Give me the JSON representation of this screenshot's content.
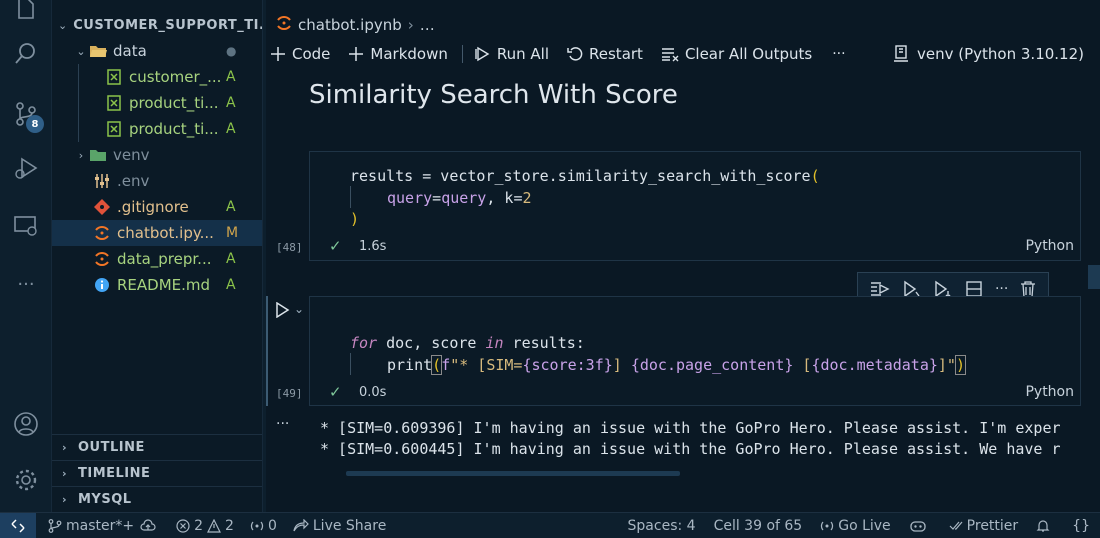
{
  "explorer": {
    "root": "CUSTOMER_SUPPORT_TI...",
    "items": [
      {
        "name": "data",
        "status": "●"
      },
      {
        "name": "customer_...",
        "status": "A"
      },
      {
        "name": "product_ti...",
        "status": "A"
      },
      {
        "name": "product_ti...",
        "status": "A"
      },
      {
        "name": "venv",
        "status": ""
      },
      {
        "name": ".env",
        "status": ""
      },
      {
        "name": ".gitignore",
        "status": "A"
      },
      {
        "name": "chatbot.ipy...",
        "status": "M"
      },
      {
        "name": "data_prepr...",
        "status": "A"
      },
      {
        "name": "README.md",
        "status": "A"
      }
    ],
    "sections": [
      "OUTLINE",
      "TIMELINE",
      "MYSQL"
    ]
  },
  "activity": {
    "source_control_badge": "8"
  },
  "editor": {
    "breadcrumb_file": "chatbot.ipynb",
    "breadcrumb_more": "…",
    "toolbar": {
      "code": "Code",
      "markdown": "Markdown",
      "run_all": "Run All",
      "restart": "Restart",
      "clear_outputs": "Clear All Outputs",
      "more": "···",
      "kernel": "venv (Python 3.10.12)"
    },
    "markdown_heading": "Similarity Search With Score",
    "cell1": {
      "line1_a": "results = vector_store.similarity_search_with_score",
      "line1_b": "(",
      "line2_a": "query",
      "line2_b": "=",
      "line2_c": "query",
      "line2_d": ", k",
      "line2_e": "=",
      "line2_f": "2",
      "line3": ")",
      "exec_count": "[48]",
      "check": "✓",
      "time": "1.6s",
      "lang": "Python"
    },
    "cell2": {
      "line1_kw1": "for",
      "line1_mid": " doc, score ",
      "line1_kw2": "in",
      "line1_end": " results:",
      "line2_fn": "print",
      "line2_p1": "(",
      "line2_f": "f",
      "line2_s1": "\"* [SIM=",
      "line2_v1": "{score:3f}",
      "line2_s2": "] ",
      "line2_v2": "{doc.page_content}",
      "line2_s3": " [",
      "line2_v3": "{doc.metadata}",
      "line2_s4": "]\"",
      "line2_p2": ")",
      "exec_count": "[49]",
      "check": "✓",
      "time": "0.0s",
      "lang": "Python"
    },
    "output": {
      "more": "···",
      "lines": [
        "* [SIM=0.609396] I'm having an issue with the GoPro Hero. Please assist. I'm exper",
        "* [SIM=0.600445] I'm having an issue with the GoPro Hero. Please assist. We have r"
      ]
    }
  },
  "status_bar": {
    "branch": "master*+",
    "errors": "2",
    "warnings": "2",
    "ports": "0",
    "live_share": "Live Share",
    "spaces": "Spaces: 4",
    "cell": "Cell 39 of 65",
    "go_live": "Go Live",
    "prettier": "Prettier",
    "braces": "{}"
  }
}
